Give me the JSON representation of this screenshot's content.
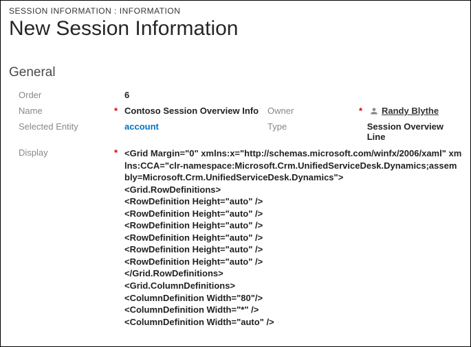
{
  "breadcrumb": "SESSION INFORMATION : INFORMATION",
  "title": "New Session Information",
  "section": "General",
  "fields": {
    "order": {
      "label": "Order",
      "value": "6"
    },
    "name": {
      "label": "Name",
      "value": "Contoso Session Overview Info",
      "required": true
    },
    "selectedEntity": {
      "label": "Selected Entity",
      "value": "account"
    },
    "display": {
      "label": "Display",
      "required": true
    },
    "owner": {
      "label": "Owner",
      "value": "Randy Blythe",
      "required": true
    },
    "type": {
      "label": "Type",
      "value": "Session Overview Line"
    }
  },
  "displayXaml": "<Grid Margin=\"0\" xmlns:x=\"http://schemas.microsoft.com/winfx/2006/xaml\" xmlns:CCA=\"clr-namespace:Microsoft.Crm.UnifiedServiceDesk.Dynamics;assembly=Microsoft.Crm.UnifiedServiceDesk.Dynamics\">\n<Grid.RowDefinitions>\n<RowDefinition Height=\"auto\" />\n<RowDefinition Height=\"auto\" />\n<RowDefinition Height=\"auto\" />\n<RowDefinition Height=\"auto\" />\n<RowDefinition Height=\"auto\" />\n<RowDefinition Height=\"auto\" />\n</Grid.RowDefinitions>\n<Grid.ColumnDefinitions>\n<ColumnDefinition Width=\"80\"/>\n<ColumnDefinition Width=\"*\" />\n<ColumnDefinition Width=\"auto\" />"
}
